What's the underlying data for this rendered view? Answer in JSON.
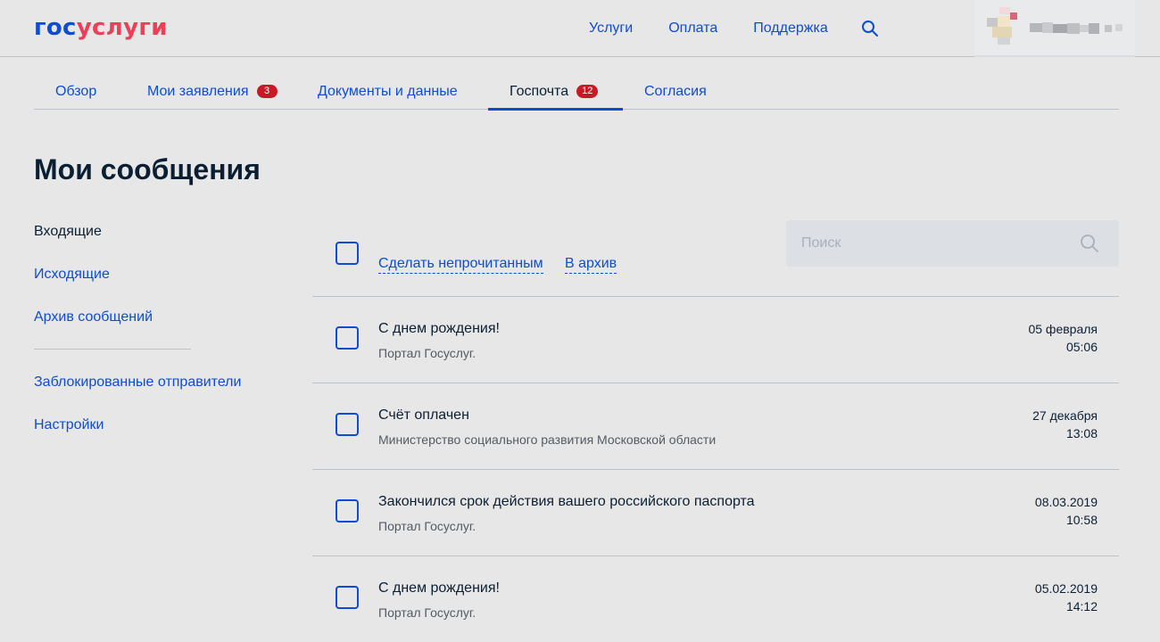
{
  "header": {
    "logo_part1": "гос",
    "logo_part2": "услуги",
    "nav": [
      "Услуги",
      "Оплата",
      "Поддержка"
    ]
  },
  "tabs": [
    {
      "label": "Обзор",
      "badge": null,
      "active": false
    },
    {
      "label": "Мои заявления",
      "badge": "3",
      "active": false
    },
    {
      "label": "Документы и данные",
      "badge": null,
      "active": false
    },
    {
      "label": "Госпочта",
      "badge": "12",
      "active": true
    },
    {
      "label": "Согласия",
      "badge": null,
      "active": false
    }
  ],
  "page": {
    "title": "Мои сообщения"
  },
  "sidebar": {
    "items": [
      "Входящие",
      "Исходящие",
      "Архив сообщений"
    ],
    "extra": [
      "Заблокированные отправители",
      "Настройки"
    ],
    "active_index": 0
  },
  "toolbar": {
    "mark_unread": "Сделать непрочитанным",
    "archive": "В архив"
  },
  "search": {
    "placeholder": "Поиск"
  },
  "messages": [
    {
      "subject": "С днем рождения!",
      "sender": "Портал Госуслуг.",
      "date": "05 февраля",
      "time": "05:06"
    },
    {
      "subject": "Счёт оплачен",
      "sender": "Министерство социального развития Московской области",
      "date": "27 декабря",
      "time": "13:08"
    },
    {
      "subject": "Закончился срок действия вашего российского паспорта",
      "sender": "Портал Госуслуг.",
      "date": "08.03.2019",
      "time": "10:58"
    },
    {
      "subject": "С днем рождения!",
      "sender": "Портал Госуслуг.",
      "date": "05.02.2019",
      "time": "14:12"
    }
  ],
  "colors": {
    "brand_blue": "#0d4cd3",
    "brand_red": "#ee3f58",
    "badge_red": "#c71a25",
    "background": "#e7e7e8",
    "text": "#0b1f33"
  },
  "icons": {
    "top_search": "search-icon",
    "input_search": "search-icon"
  }
}
